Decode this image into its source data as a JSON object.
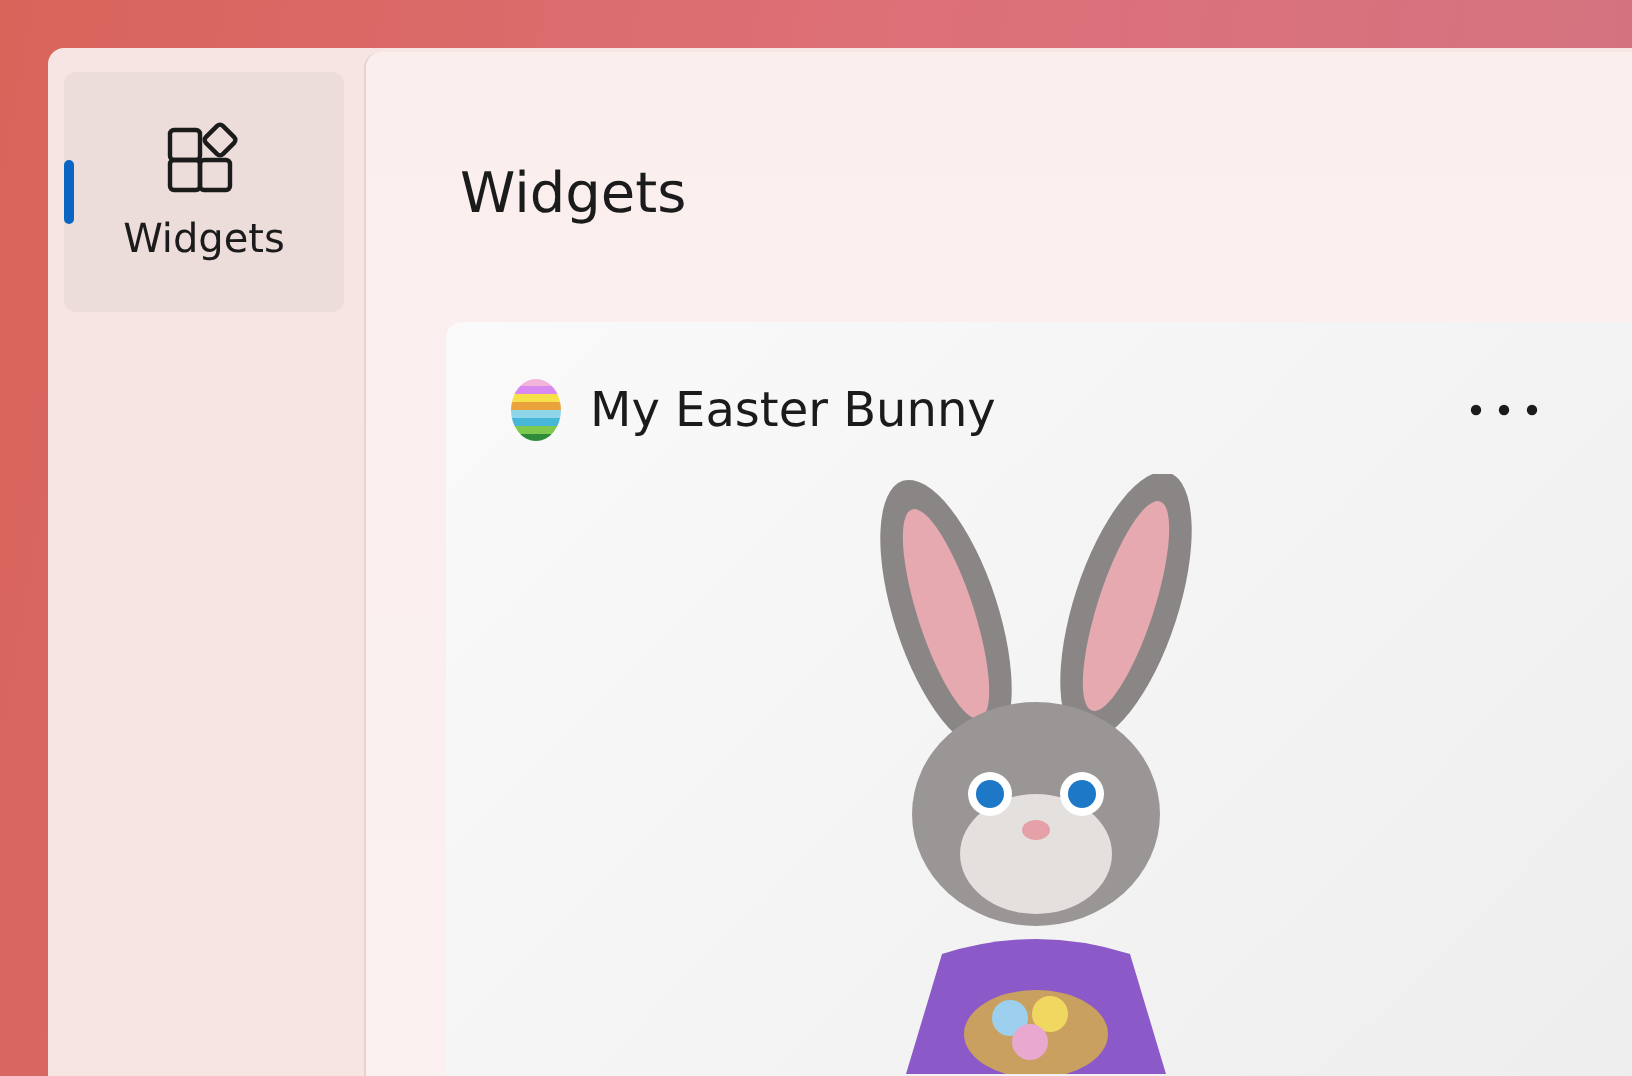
{
  "sidebar": {
    "items": [
      {
        "label": "Widgets",
        "selected": true
      }
    ]
  },
  "main": {
    "title": "Widgets"
  },
  "widget": {
    "title": "My Easter Bunny"
  }
}
